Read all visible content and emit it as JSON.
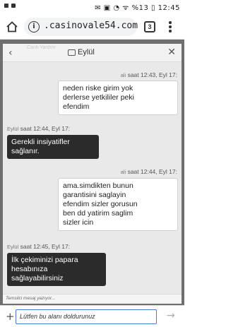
{
  "status_bar": {
    "icons_text": "✉ ▣ ◔ ᯤ %13 ▯ 12:45"
  },
  "browser": {
    "url": ".casinovale54.com",
    "tab_count": "3"
  },
  "chat": {
    "header_title": "Eylül",
    "ghost_header": "Canlı Yardım",
    "messages": [
      {
        "sender": "user",
        "who": "ali",
        "time": "saat 12:43, Eyl 17:",
        "lines": [
          "neden riske girim yok",
          "derlerse yetkililer peki",
          "efendim"
        ]
      },
      {
        "sender": "agent",
        "who": "Eylül",
        "time": "saat 12:44, Eyl 17:",
        "lines": [
          "Gerekli insiyatifler",
          "sağlanır."
        ]
      },
      {
        "sender": "user",
        "who": "ali",
        "time": "saat 12:44, Eyl 17:",
        "lines": [
          "ama.simdikten bunun",
          "garantisini saglayin",
          "efendim sizler gorusun",
          "ben dd yatirim saglim",
          "sizler icin"
        ]
      },
      {
        "sender": "agent",
        "who": "Eylül",
        "time": "saat 12:45, Eyl 17:",
        "lines": [
          "İlk çekiminizi papara",
          "hesabınıza",
          "sağlayabilirsiniz"
        ]
      }
    ],
    "typing_indicator": "Temsilci mesaj yazıyor...",
    "input_value": "Lütfen bu alanı doldurunuz"
  },
  "colors": {
    "user_bubble": "#ffffff",
    "agent_bubble": "#2b2b2b",
    "input_border": "#4a7bd0"
  }
}
